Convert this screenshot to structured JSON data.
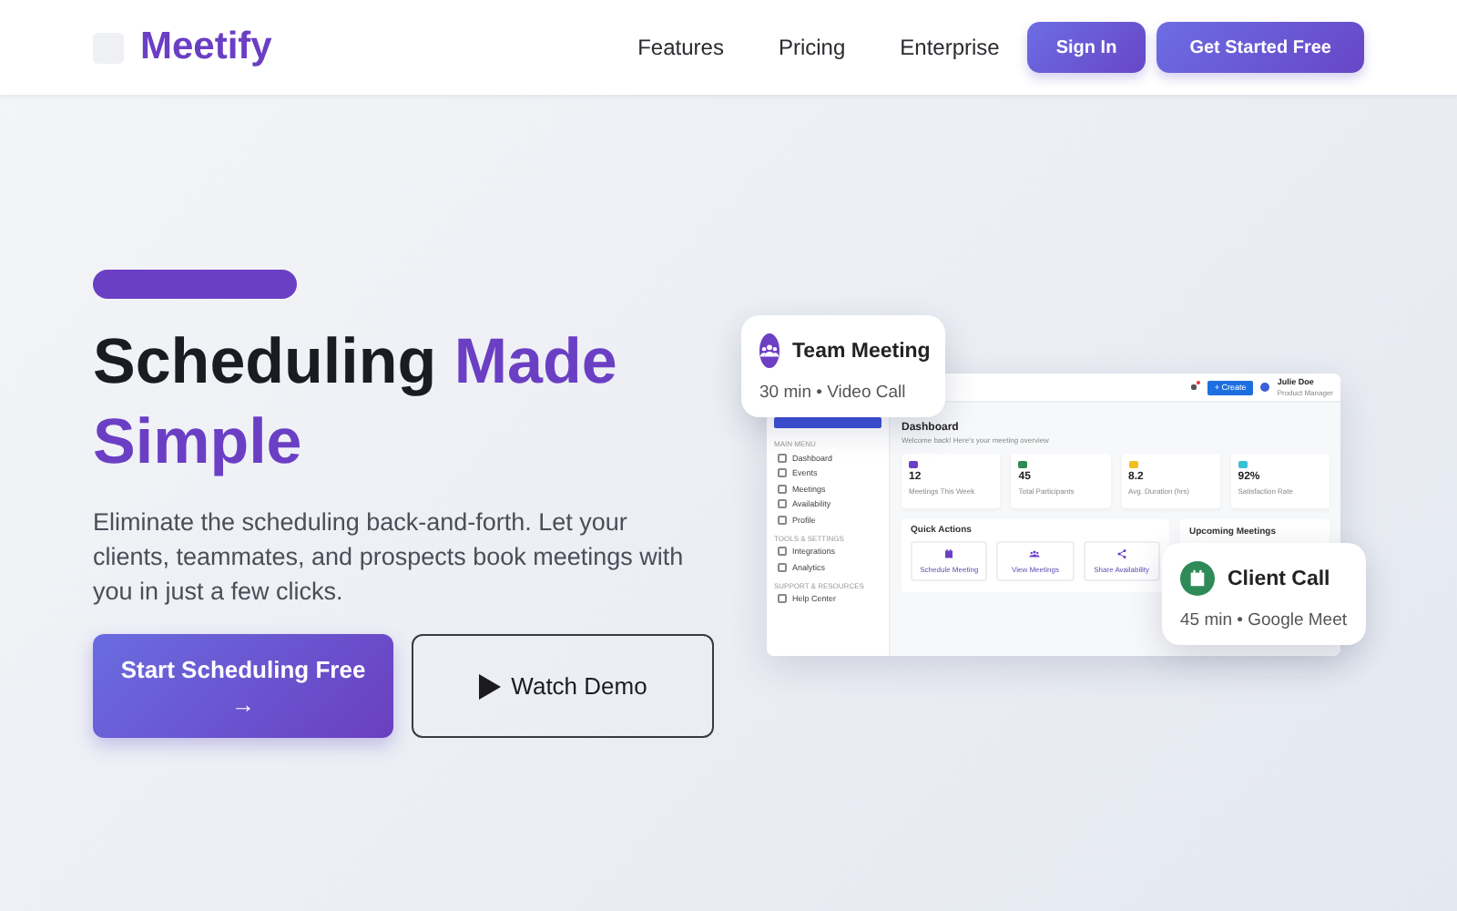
{
  "nav": {
    "brand": "Meetify",
    "links": [
      {
        "label": "Features"
      },
      {
        "label": "Pricing"
      },
      {
        "label": "Enterprise"
      }
    ],
    "buttons": [
      {
        "label": "Sign In",
        "kind": "secondary"
      },
      {
        "label": "Get Started Free",
        "kind": "primary"
      }
    ]
  },
  "hero": {
    "heading": [
      {
        "text": "Scheduling",
        "accent": false
      },
      {
        "text": "Made Simple",
        "accent": true
      }
    ],
    "description": "Eliminate the scheduling back-and-forth. Let your clients, teammates, and prospects book meetings with you in just a few clicks.",
    "primary_button": {
      "label": "Start Scheduling Free",
      "arrow": "→"
    },
    "secondary_button": {
      "label": "Watch Demo"
    }
  },
  "preview": {
    "topbar": {
      "create_button": "+ Create",
      "user_name": "Julie Doe",
      "user_role": "Product Manager"
    },
    "sidebar": {
      "sections": [
        {
          "title": "MAIN MENU",
          "items": [
            "Dashboard",
            "Events",
            "Meetings",
            "Availability",
            "Profile"
          ]
        },
        {
          "title": "TOOLS & SETTINGS",
          "items": [
            "Integrations",
            "Analytics"
          ]
        },
        {
          "title": "SUPPORT & RESOURCES",
          "items": [
            "Help Center"
          ]
        }
      ]
    },
    "title": "Dashboard",
    "subtitle": "Welcome back! Here's your meeting overview",
    "stats": [
      {
        "value": "12",
        "label": "Meetings This Week",
        "color": "#6d3fc4"
      },
      {
        "value": "45",
        "label": "Total Participants",
        "color": "#2e8b57"
      },
      {
        "value": "8.2",
        "label": "Avg. Duration (hrs)",
        "color": "#f2c01e"
      },
      {
        "value": "92%",
        "label": "Satisfaction Rate",
        "color": "#3cc0d6"
      }
    ],
    "quick_actions": {
      "title": "Quick Actions",
      "items": [
        {
          "label": "Schedule Meeting",
          "kind": "calendar"
        },
        {
          "label": "View Meetings",
          "kind": "people"
        },
        {
          "label": "Share Availability",
          "kind": "share"
        }
      ]
    },
    "upcoming_title": "Upcoming Meetings"
  },
  "floating_cards": [
    {
      "title": "Team Meeting",
      "detail": "30 min • Video Call",
      "kind": "people",
      "color": "#6d3fc4"
    },
    {
      "title": "Client Call",
      "detail": "45 min • Google Meet",
      "kind": "calendar",
      "color": "#2e8b57"
    }
  ]
}
